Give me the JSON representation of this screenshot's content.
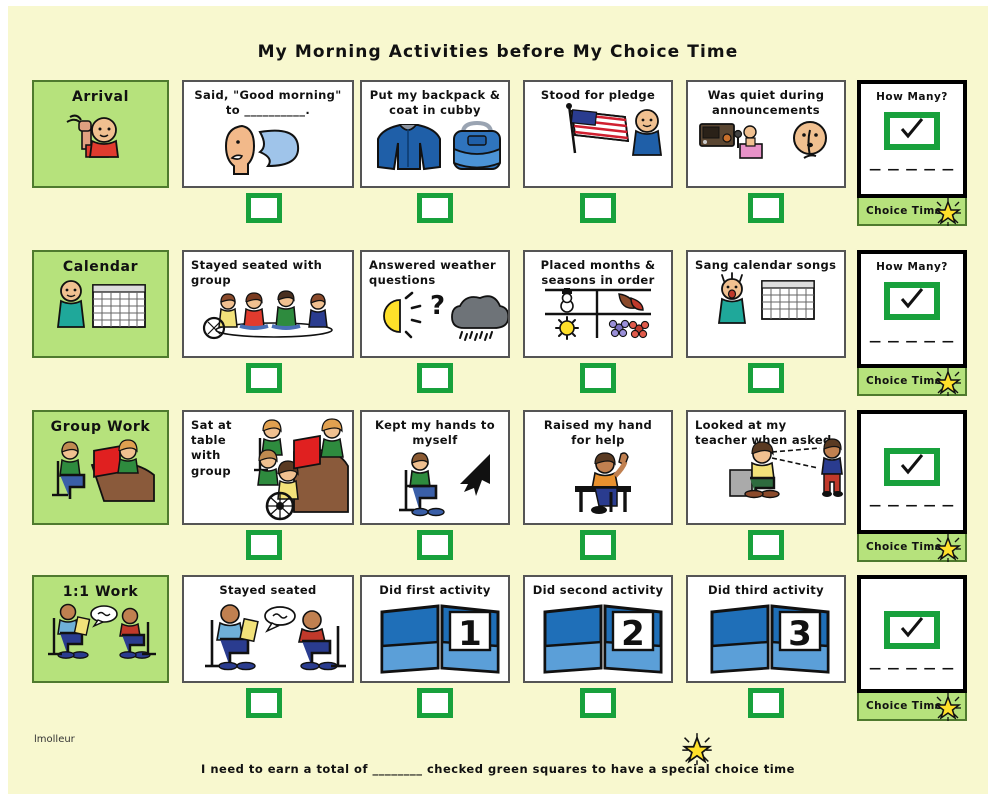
{
  "page": {
    "title": "My Morning Activities before My Choice Time",
    "background_color": "#f8f8cf",
    "accent_green": "#b6e27c",
    "check_green": "#18a13c",
    "signature": "lmolleur",
    "footer_text": "I need to earn a total of ________ checked green squares to have a special choice time"
  },
  "tally_panel": {
    "how_many_label": "How Many?",
    "dash_line": "— — — — —",
    "choice_time_label": "Choice Time",
    "check_mark": "✓"
  },
  "rows": [
    {
      "category": "Arrival",
      "category_icon": "waving-child-icon",
      "show_how_many": true,
      "activities": [
        {
          "text": "Said, \"Good morning\" to __________.",
          "align": "center",
          "icon": "speaking-head-icon"
        },
        {
          "text": "Put my backpack & coat in cubby",
          "align": "center",
          "icon": "coat-backpack-icon"
        },
        {
          "text": "Stood for pledge",
          "align": "center",
          "icon": "flag-pledge-icon"
        },
        {
          "text": "Was quiet during announcements",
          "align": "center",
          "icon": "quiet-announcements-icon"
        }
      ]
    },
    {
      "category": "Calendar",
      "category_icon": "calendar-person-icon",
      "show_how_many": true,
      "activities": [
        {
          "text": "Stayed seated with group",
          "align": "left",
          "icon": "group-seated-icon"
        },
        {
          "text": "Answered weather questions",
          "align": "left",
          "icon": "weather-icon"
        },
        {
          "text": "Placed months & seasons in order",
          "align": "center",
          "icon": "seasons-grid-icon"
        },
        {
          "text": "Sang calendar songs",
          "align": "left",
          "icon": "singing-calendar-icon"
        }
      ]
    },
    {
      "category": "Group Work",
      "category_icon": "group-table-icon",
      "show_how_many": false,
      "activities": [
        {
          "text": "Sat at table with group",
          "align": "left",
          "icon": "table-group-icon"
        },
        {
          "text": "Kept my hands to myself",
          "align": "center",
          "icon": "hands-to-self-icon"
        },
        {
          "text": "Raised my hand for help",
          "align": "center",
          "icon": "raised-hand-icon"
        },
        {
          "text": "Looked at my teacher when asked",
          "align": "left",
          "icon": "eye-contact-icon"
        }
      ]
    },
    {
      "category": "1:1 Work",
      "category_icon": "one-on-one-icon",
      "show_how_many": false,
      "activities": [
        {
          "text": "Stayed seated",
          "align": "center",
          "icon": "seated-pair-icon"
        },
        {
          "text": "Did first activity",
          "align": "center",
          "icon": "folder-1-icon",
          "folder_number": "1"
        },
        {
          "text": "Did second activity",
          "align": "center",
          "icon": "folder-2-icon",
          "folder_number": "2"
        },
        {
          "text": "Did third activity",
          "align": "center",
          "icon": "folder-3-icon",
          "folder_number": "3"
        }
      ]
    }
  ]
}
